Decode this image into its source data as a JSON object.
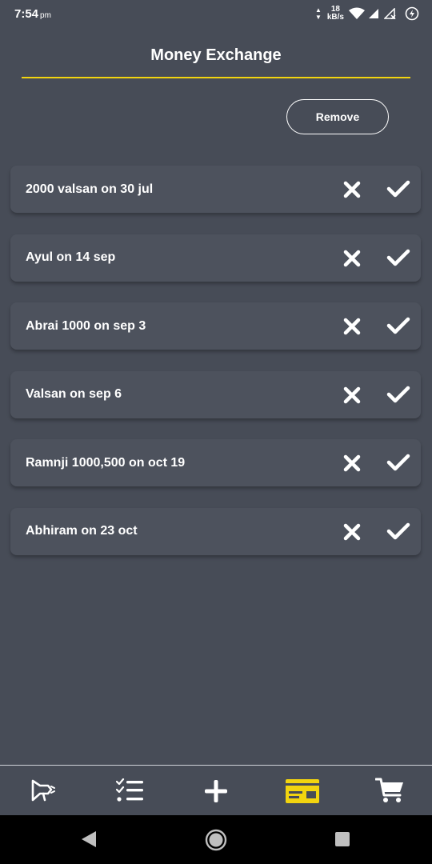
{
  "status_bar": {
    "time": "7:54",
    "ampm": "pm",
    "net_speed_value": "18",
    "net_speed_unit": "kB/s"
  },
  "header": {
    "title": "Money Exchange",
    "accent_color": "#f2d40f"
  },
  "actions": {
    "remove_label": "Remove"
  },
  "entries": [
    {
      "text": "2000 valsan on 30 jul"
    },
    {
      "text": "Ayul on 14 sep"
    },
    {
      "text": "Abrai 1000 on sep 3"
    },
    {
      "text": "Valsan on sep 6"
    },
    {
      "text": "Ramnji 1000,500 on oct 19"
    },
    {
      "text": "Abhiram on 23 oct"
    }
  ],
  "bottom_nav": {
    "items": [
      {
        "icon": "megaphone-icon",
        "active": false
      },
      {
        "icon": "checklist-icon",
        "active": false
      },
      {
        "icon": "plus-icon",
        "active": false
      },
      {
        "icon": "card-icon",
        "active": true
      },
      {
        "icon": "cart-icon",
        "active": false
      }
    ],
    "active_color": "#f2d40f"
  },
  "system_nav": {
    "buttons": [
      "back-icon",
      "home-icon",
      "recents-icon"
    ]
  }
}
